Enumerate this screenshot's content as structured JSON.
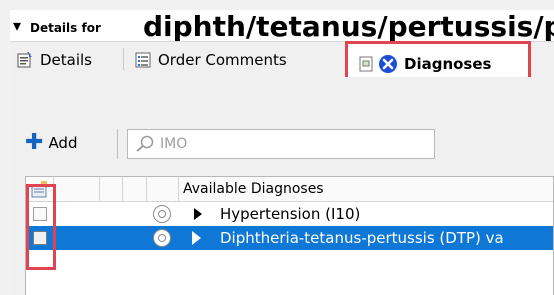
{
  "header": {
    "collapse_glyph": "▾",
    "prefix": "Details for",
    "title": "diphth/tetanus/pertussis/pe"
  },
  "tabs": [
    {
      "label": "Details",
      "icon": "details-sheet-icon"
    },
    {
      "label": "Order Comments",
      "icon": "comments-list-icon"
    },
    {
      "label": "Diagnoses",
      "icon": "diagnoses-icon",
      "active": true
    }
  ],
  "toolbar": {
    "add_label": "Add",
    "search_placeholder": "IMO"
  },
  "grid": {
    "column_header": "Available Diagnoses",
    "rows": [
      {
        "label": "Hypertension (I10)",
        "selected": false
      },
      {
        "label": "Diphtheria-tetanus-pertussis (DTP) va",
        "selected": true
      }
    ]
  },
  "colors": {
    "highlight_red": "#e0454f",
    "selection_blue": "#0f78d7",
    "add_blue": "#1565c0",
    "diagnoses_icon_blue": "#1a4fd6"
  }
}
